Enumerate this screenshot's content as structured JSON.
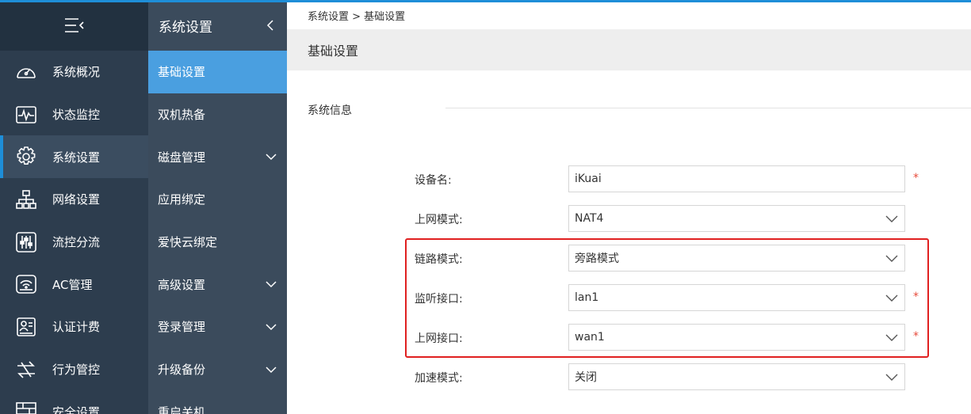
{
  "colors": {
    "accent": "#1e8ed8",
    "active_sub": "#4a9fe0",
    "required": "#e74c3c",
    "highlight": "#e02020"
  },
  "nav": {
    "items": [
      {
        "label": "系统概况",
        "icon": "dashboard-icon"
      },
      {
        "label": "状态监控",
        "icon": "monitor-icon"
      },
      {
        "label": "系统设置",
        "icon": "gear-icon"
      },
      {
        "label": "网络设置",
        "icon": "network-icon"
      },
      {
        "label": "流控分流",
        "icon": "sliders-icon"
      },
      {
        "label": "AC管理",
        "icon": "wifi-router-icon"
      },
      {
        "label": "认证计费",
        "icon": "id-card-icon"
      },
      {
        "label": "行为管控",
        "icon": "transfer-icon"
      },
      {
        "label": "安全设置",
        "icon": "wall-icon"
      }
    ]
  },
  "subnav": {
    "title": "系统设置",
    "items": [
      {
        "label": "基础设置"
      },
      {
        "label": "双机热备"
      },
      {
        "label": "磁盘管理"
      },
      {
        "label": "应用绑定"
      },
      {
        "label": "爱快云绑定"
      },
      {
        "label": "高级设置"
      },
      {
        "label": "登录管理"
      },
      {
        "label": "升级备份"
      },
      {
        "label": "重启关机"
      }
    ]
  },
  "main": {
    "breadcrumb": "系统设置 > 基础设置",
    "title": "基础设置",
    "section": "系统信息",
    "form": {
      "device_name": {
        "label": "设备名:",
        "value": "iKuai",
        "required": "*"
      },
      "internet_mode": {
        "label": "上网模式:",
        "value": "NAT4"
      },
      "link_mode": {
        "label": "链路模式:",
        "value": "旁路模式"
      },
      "listen_iface": {
        "label": "监听接口:",
        "value": "lan1",
        "required": "*"
      },
      "uplink_iface": {
        "label": "上网接口:",
        "value": "wan1",
        "required": "*"
      },
      "accel_mode": {
        "label": "加速模式:",
        "value": "关闭"
      }
    }
  }
}
